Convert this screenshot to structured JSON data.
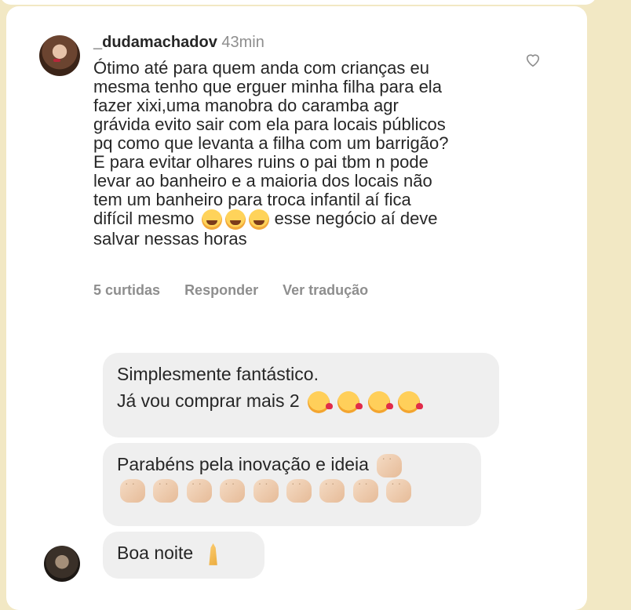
{
  "comment": {
    "username": "_dudamachadov",
    "time": "43min",
    "text_lines": [
      "Ótimo até para quem anda com crianças eu",
      "mesma tenho que erguer minha filha para ela",
      "fazer xixi,uma manobra do caramba agr",
      "grávida evito sair com ela para locais públicos",
      "pq como que levanta a filha com um barrigão?",
      "E para evitar olhares ruins o pai tbm n pode",
      "levar ao banheiro e a maioria dos locais não",
      "tem um banheiro para troca infantil aí fica",
      "difícil mesmo",
      "esse negócio aí deve",
      "salvar nessas horas"
    ],
    "likes": "5 curtidas",
    "reply_label": "Responder",
    "translate_label": "Ver tradução"
  },
  "messages": [
    {
      "line1": "Simplesmente fantástico.",
      "line2": "Já vou comprar mais 2"
    },
    {
      "line1": "Parabéns pela inovação e ideia"
    },
    {
      "line1": "Boa noite"
    }
  ],
  "icons": {
    "heart": "heart-icon",
    "kiss_emoji": "face-blowing-kiss-icon",
    "laugh_emoji": "tears-of-joy-icon",
    "clap_emoji": "clapping-hands-icon",
    "pray_emoji": "folded-hands-icon"
  }
}
